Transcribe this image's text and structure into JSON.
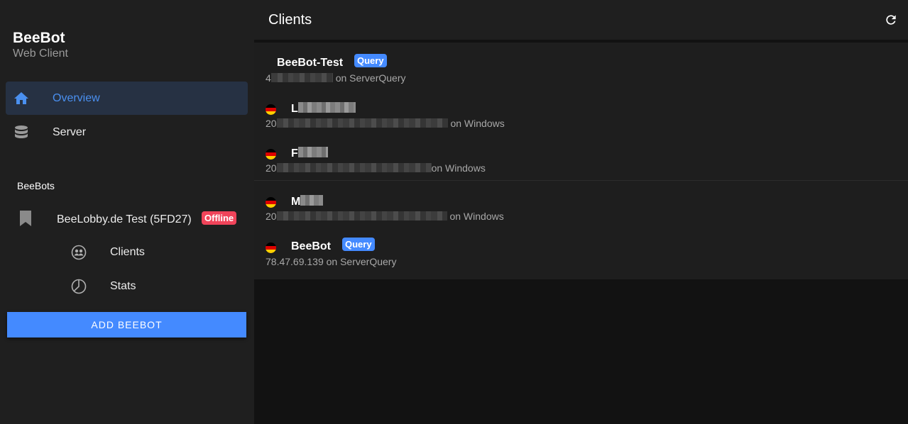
{
  "brand": {
    "title": "BeeBot",
    "subtitle": "Web Client"
  },
  "nav": [
    {
      "label": "Overview",
      "icon": "home-icon",
      "active": true
    },
    {
      "label": "Server",
      "icon": "database-icon",
      "active": false
    }
  ],
  "section": {
    "label": "BeeBots"
  },
  "bot": {
    "name": "BeeLobby.de Test (5FD27)",
    "status": "Offline",
    "icon": "bookmark-icon"
  },
  "bot_items": [
    {
      "label": "Clients",
      "icon": "users-circle-icon"
    },
    {
      "label": "Stats",
      "icon": "pie-chart-icon"
    }
  ],
  "add_button": {
    "label": "ADD BEEBOT"
  },
  "header": {
    "title": "Clients",
    "refresh_icon": "refresh-icon"
  },
  "clients": [
    {
      "name": "BeeBot-Test",
      "badge": "Query",
      "prefix": "4",
      "detail": "on ServerQuery",
      "flag": false
    },
    {
      "name": "L",
      "badge": "",
      "prefix": "20",
      "detail": "on Windows",
      "flag": true
    },
    {
      "name": "F",
      "badge": "",
      "prefix": "20",
      "detail": "on Windows",
      "flag": true
    },
    {
      "name": "M",
      "badge": "",
      "prefix": "20",
      "detail": "on Windows",
      "flag": true
    },
    {
      "name": "BeeBot",
      "badge": "Query",
      "prefix": "",
      "detail": "78.47.69.139 on ServerQuery",
      "flag": true
    }
  ],
  "colors": {
    "accent": "#448aff",
    "offline": "#f0445a",
    "active_nav_bg": "#263143",
    "sidebar_bg": "#1f1f1f"
  }
}
